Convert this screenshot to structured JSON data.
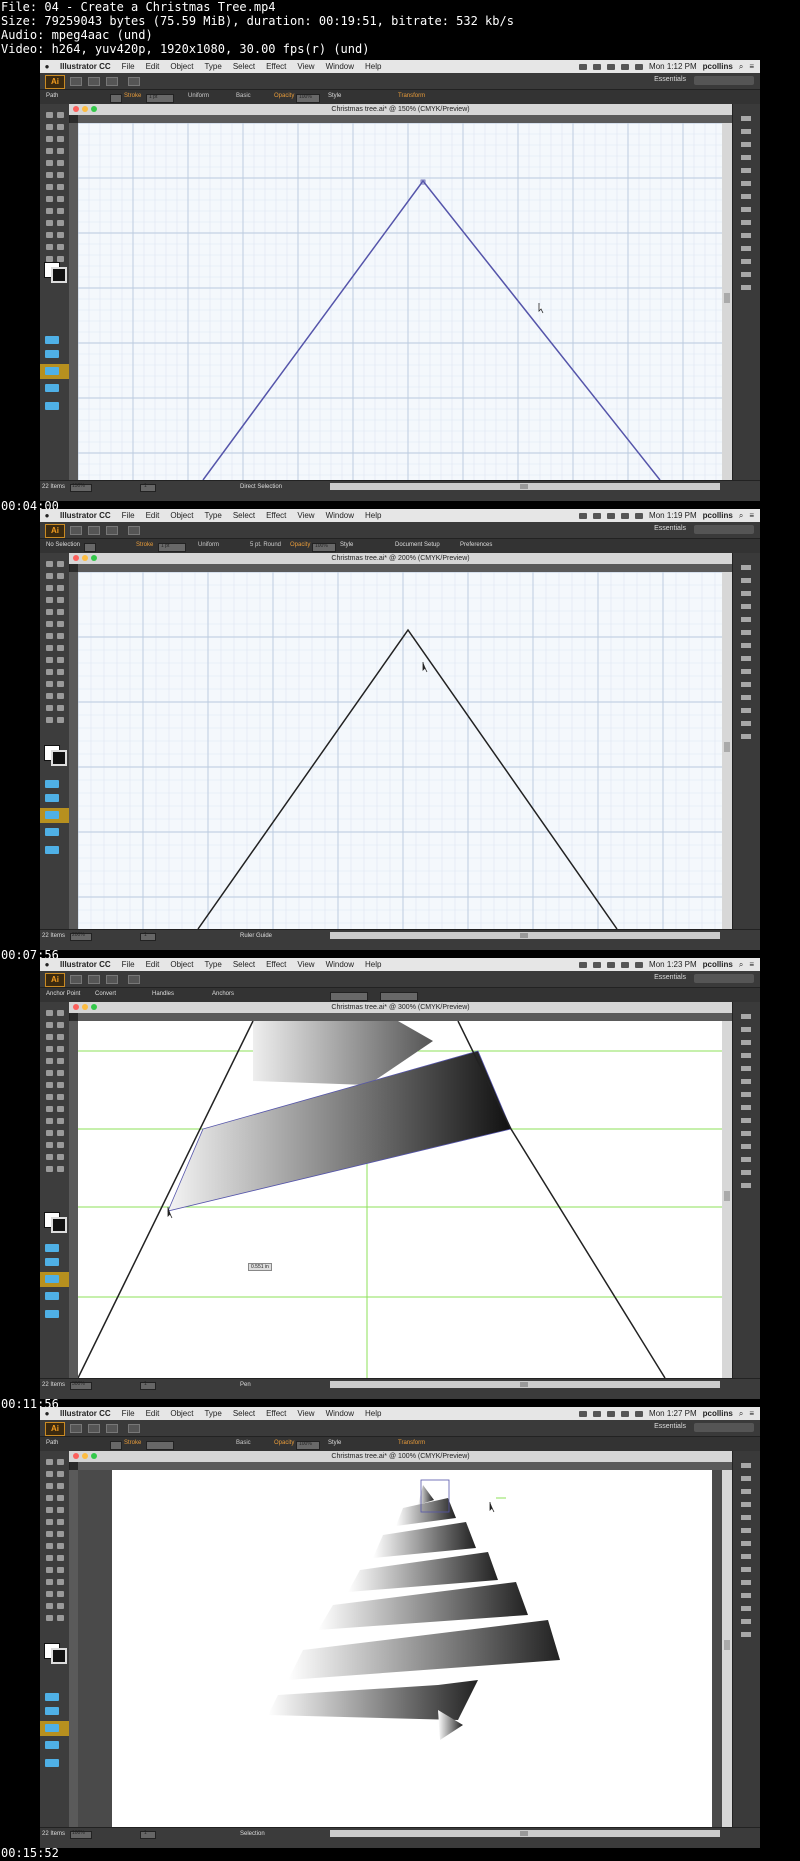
{
  "header": {
    "file": "File: 04 - Create a Christmas Tree.mp4",
    "size": "Size: 79259043 bytes (75.59 MiB), duration: 00:19:51, bitrate: 532 kb/s",
    "audio": "Audio: mpeg4aac (und)",
    "video": "Video: h264, yuv420p, 1920x1080, 30.00 fps(r) (und)"
  },
  "menu": [
    "Illustrator CC",
    "File",
    "Edit",
    "Object",
    "Type",
    "Select",
    "Effect",
    "View",
    "Window",
    "Help"
  ],
  "user": "pcollins",
  "workspace": "Essentials",
  "app_logo": "Ai",
  "frames": [
    {
      "timestamp": "00:04:00",
      "clock": "Mon 1:12 PM",
      "doc_title": "Christmas tree.ai* @ 150% (CMYK/Preview)",
      "control_label": "Path",
      "stroke_label": "Stroke",
      "stroke_value": "1 pt",
      "profile": "Uniform",
      "brush": "Basic",
      "opacity_label": "Opacity",
      "opacity": "100%",
      "style_label": "Style",
      "extra_label": "Transform",
      "zoom": "150%",
      "tool_status": "Direct Selection",
      "artboard": "1",
      "item_count": "22 Items"
    },
    {
      "timestamp": "00:07:56",
      "clock": "Mon 1:19 PM",
      "doc_title": "Christmas tree.ai* @ 200% (CMYK/Preview)",
      "control_label": "No Selection",
      "stroke_label": "Stroke",
      "stroke_value": "1 pt",
      "profile": "Uniform",
      "brush": "5 pt. Round",
      "opacity_label": "Opacity",
      "opacity": "100%",
      "style_label": "Style",
      "extra_label": "Document Setup",
      "extra_label2": "Preferences",
      "zoom": "200%",
      "tool_status": "Ruler Guide",
      "artboard": "1",
      "item_count": "22 Items"
    },
    {
      "timestamp": "00:11:56",
      "clock": "Mon 1:23 PM",
      "doc_title": "Christmas tree.ai* @ 300% (CMYK/Preview)",
      "control_label": "Anchor Point",
      "convert_label": "Convert",
      "handles_label": "Handles",
      "anchors_label": "Anchors",
      "zoom": "300%",
      "tool_status": "Pen",
      "artboard": "1",
      "item_count": "22 Items",
      "measure": "0.551 in"
    },
    {
      "timestamp": "00:15:52",
      "clock": "Mon 1:27 PM",
      "doc_title": "Christmas tree.ai* @ 100% (CMYK/Preview)",
      "control_label": "Path",
      "stroke_label": "Stroke",
      "brush": "Basic",
      "opacity_label": "Opacity",
      "opacity": "100%",
      "style_label": "Style",
      "extra_label": "Transform",
      "zoom": "100%",
      "tool_status": "Selection",
      "artboard": "1",
      "item_count": "22 Items"
    }
  ],
  "colors": {
    "accent_orange": "#e79b3a",
    "guide_green": "#8ee05a",
    "path_blue": "#5555aa",
    "folder_blue": "#4fb0e6",
    "folder_selected": "#b7901f"
  }
}
